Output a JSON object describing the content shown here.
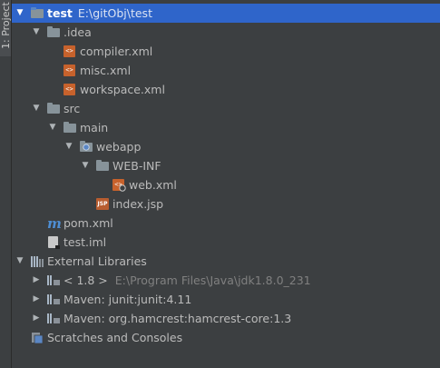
{
  "side_tab": {
    "label": "1: Project"
  },
  "tree": {
    "project": {
      "name": "test",
      "path": "E:\\gitObj\\test"
    },
    "idea": {
      "name": ".idea",
      "files": [
        "compiler.xml",
        "misc.xml",
        "workspace.xml"
      ]
    },
    "src": {
      "name": "src"
    },
    "main": {
      "name": "main"
    },
    "webapp": {
      "name": "webapp"
    },
    "webinf": {
      "name": "WEB-INF"
    },
    "web_xml": {
      "name": "web.xml"
    },
    "index_jsp": {
      "name": "index.jsp"
    },
    "pom": {
      "name": "pom.xml"
    },
    "iml": {
      "name": "test.iml"
    },
    "external": {
      "name": "External Libraries",
      "items": [
        {
          "name": "< 1.8 >",
          "hint": "E:\\Program Files\\Java\\jdk1.8.0_231"
        },
        {
          "name": "Maven: junit:junit:4.11"
        },
        {
          "name": "Maven: org.hamcrest:hamcrest-core:1.3"
        }
      ]
    },
    "scratches": {
      "name": "Scratches and Consoles"
    }
  },
  "colors": {
    "background": "#3c3f41",
    "selection": "#2f65ca",
    "text": "#bbbbbb",
    "folder": "#87939a",
    "source_folder": "#5a86c4",
    "xml_icon": "#c7622c",
    "maven_icon": "#4e8ed3"
  },
  "icons": {
    "folder": "folder-icon",
    "xml": "xml-file-icon",
    "jsp": "jsp-file-icon",
    "maven": "maven-icon",
    "iml": "iml-file-icon",
    "libraries": "libraries-icon",
    "library": "library-icon",
    "scratches": "scratches-icon"
  }
}
